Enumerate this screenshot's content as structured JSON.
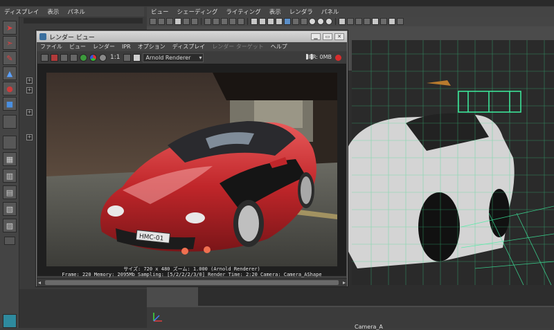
{
  "left_menubar": {
    "items": [
      "ディスプレイ",
      "表示",
      "パネル"
    ]
  },
  "viewport_menubar": {
    "items": [
      "ビュー",
      "シェーディング",
      "ライティング",
      "表示",
      "レンダラ",
      "パネル"
    ]
  },
  "render_view": {
    "title": "レンダー ビュー",
    "menu": [
      "ファイル",
      "ビュー",
      "レンダー",
      "IPR",
      "オプション",
      "ディスプレイ",
      "レンダー ターゲット",
      "ヘルプ"
    ],
    "ratio": "1:1",
    "renderer": "Arnold Renderer",
    "ipr_status": "IPR: 0MB",
    "pause_icon": "pause-icon",
    "image_plate_text": "HMC-01",
    "caption_line1": "サイズ: 720 x 480  ズーム: 1.000    (Arnold Renderer)",
    "caption_line2": "Frame: 220    Memory: 2095Mb    Sampling: [5/2/2/2/3/0]    Render Time: 2:20    Camera: Camera_AShape",
    "window_buttons": {
      "minimize": "minimize-icon",
      "restore": "restore-icon",
      "close": "close-icon"
    }
  },
  "viewport": {
    "camera_label": "Camera_A"
  },
  "colors": {
    "maya_bg": "#444444",
    "grid_green": "#39d98a",
    "car_red": "#c0262a",
    "ipr_red": "#d62d2d"
  }
}
